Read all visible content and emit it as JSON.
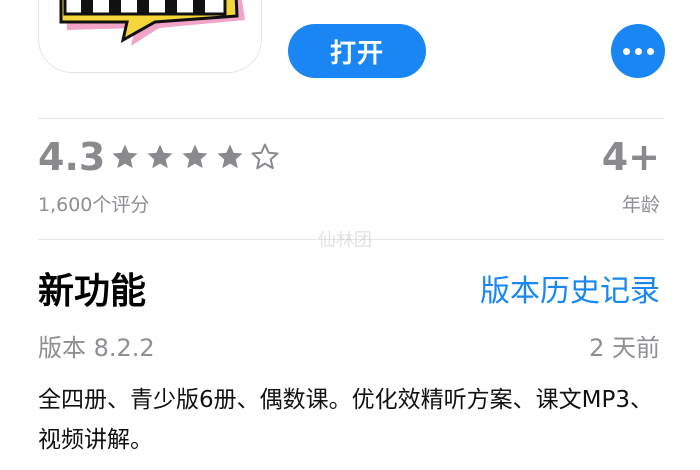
{
  "header": {
    "open_label": "打开",
    "app_icon": "piano-keys-speech-bubble",
    "more_icon": "ellipsis-icon"
  },
  "ratings": {
    "value": "4.3",
    "stars_filled": 4,
    "stars_total": 5,
    "count_label": "1,600个评分",
    "age": "4+",
    "age_label": "年龄"
  },
  "whats_new": {
    "title": "新功能",
    "history_link": "版本历史记录",
    "version": "版本 8.2.2",
    "date": "2 天前",
    "notes": "全四册、青少版6册、偶数课。优化效精听方案、课文MP3、视频讲解。"
  },
  "watermark": "仙林团",
  "colors": {
    "accent": "#1a86f3",
    "secondary_text": "#8e8e93",
    "icon_yellow": "#f4d53a"
  }
}
